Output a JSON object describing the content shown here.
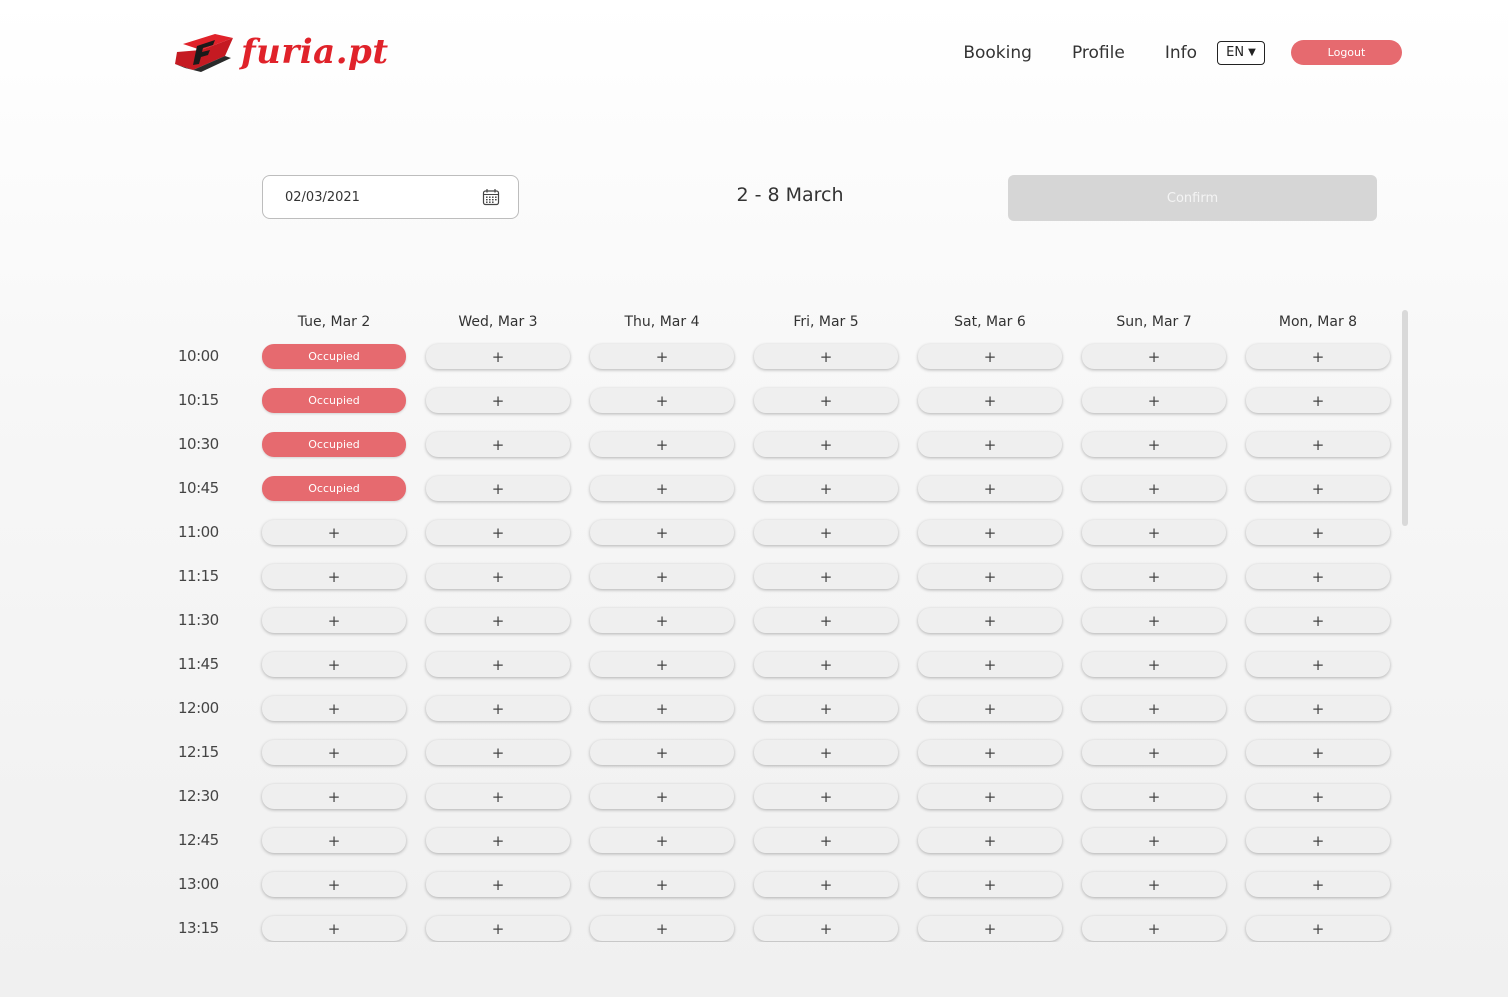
{
  "brand": {
    "name": "furia.pt",
    "logo_icon": "furia-logo-icon",
    "accent_color": "#e0222a"
  },
  "nav": {
    "links": [
      "Booking",
      "Profile",
      "Info"
    ],
    "language": "EN",
    "logout_label": "Logout",
    "logout_color": "#e66a6f"
  },
  "controls": {
    "date_value": "02/03/2021",
    "calendar_icon": "calendar-icon",
    "range_label": "2 - 8 March",
    "confirm_label": "Confirm"
  },
  "schedule": {
    "days": [
      "Tue, Mar 2",
      "Wed, Mar 3",
      "Thu, Mar 4",
      "Fri, Mar 5",
      "Sat, Mar 6",
      "Sun, Mar 7",
      "Mon, Mar 8"
    ],
    "times": [
      "10:00",
      "10:15",
      "10:30",
      "10:45",
      "11:00",
      "11:15",
      "11:30",
      "11:45",
      "12:00",
      "12:15",
      "12:30",
      "12:45",
      "13:00",
      "13:15"
    ],
    "occupied_label": "Occupied",
    "free_label": "+",
    "occupied_color": "#e66a6f",
    "occupied_slots": [
      {
        "day": 0,
        "time": 0
      },
      {
        "day": 0,
        "time": 1
      },
      {
        "day": 0,
        "time": 2
      },
      {
        "day": 0,
        "time": 3
      }
    ]
  }
}
